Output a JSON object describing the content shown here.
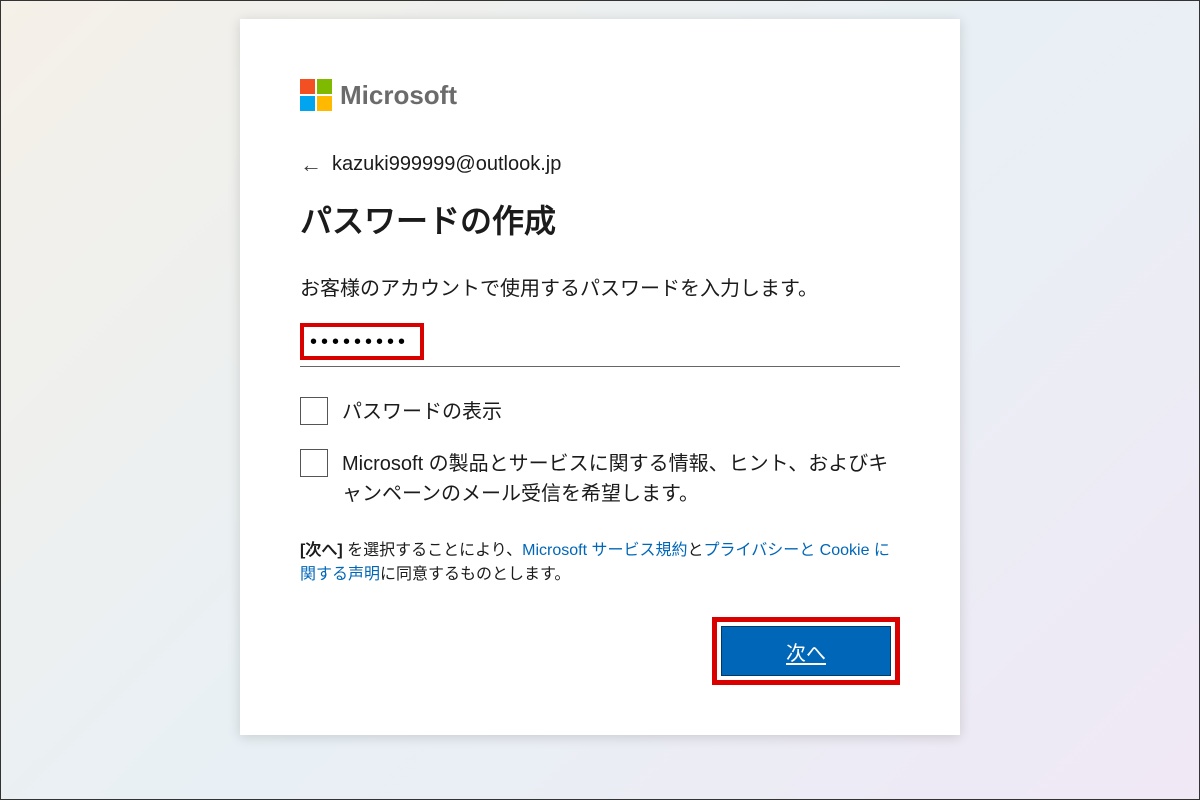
{
  "brand": "Microsoft",
  "identity": {
    "email": "kazuki999999@outlook.jp"
  },
  "title": "パスワードの作成",
  "instruction": "お客様のアカウントで使用するパスワードを入力します。",
  "password_value": "•••••••••",
  "checkboxes": {
    "show_password": "パスワードの表示",
    "marketing": "Microsoft の製品とサービスに関する情報、ヒント、およびキャンペーンのメール受信を希望します。"
  },
  "legal": {
    "prefix_bold": "[次へ]",
    "part1": " を選択することにより、",
    "link1": "Microsoft サービス規約",
    "part2": "と",
    "link2": "プライバシーと Cookie に関する声明",
    "part3": "に同意するものとします。"
  },
  "next_button": "次へ"
}
